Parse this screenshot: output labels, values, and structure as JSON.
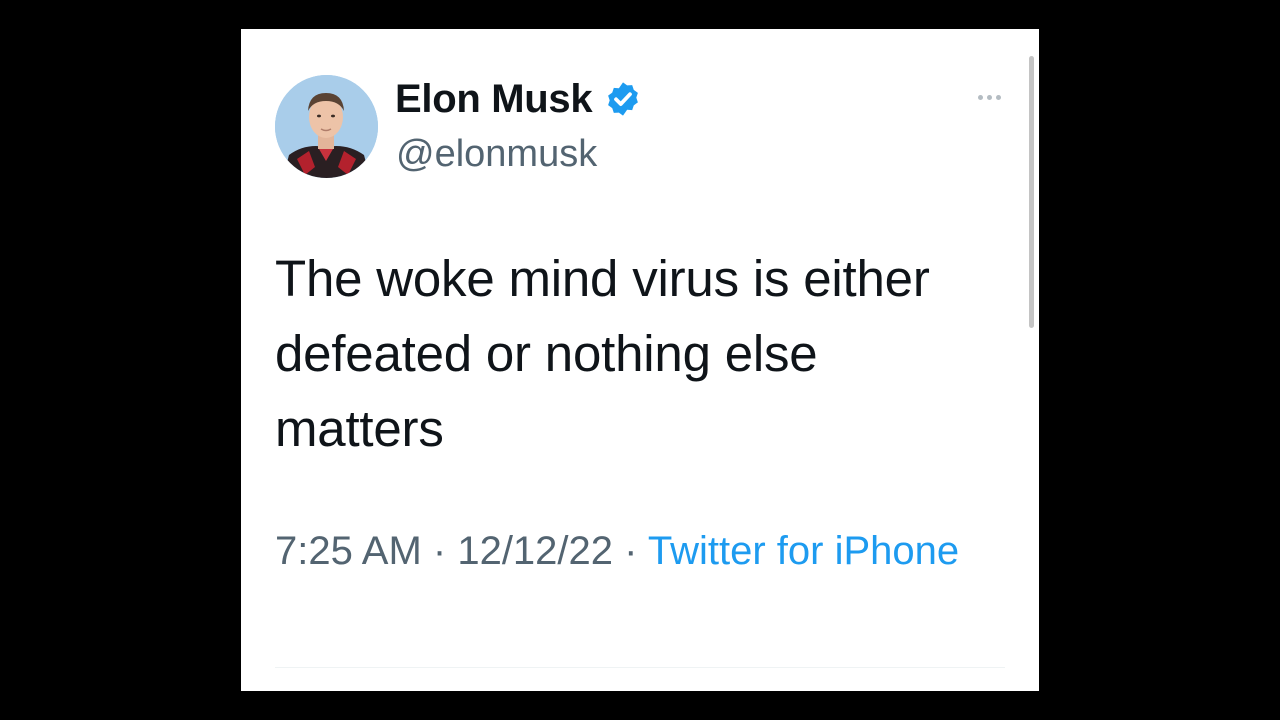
{
  "author": {
    "display_name": "Elon Musk",
    "handle": "@elonmusk",
    "avatar_icon": "profile-photo",
    "verified_icon": "verified-badge-icon",
    "verified_color": "#1d9bf0"
  },
  "tweet": {
    "text": "The woke mind virus is either defeated or nothing else matters"
  },
  "meta": {
    "time": "7:25 AM",
    "separator": "·",
    "date": "12/12/22",
    "source": "Twitter for iPhone"
  },
  "more_icon": "more-options-icon",
  "colors": {
    "background": "#000000",
    "card": "#ffffff",
    "text": "#0f1419",
    "secondary": "#536471",
    "link": "#1d9bf0"
  }
}
